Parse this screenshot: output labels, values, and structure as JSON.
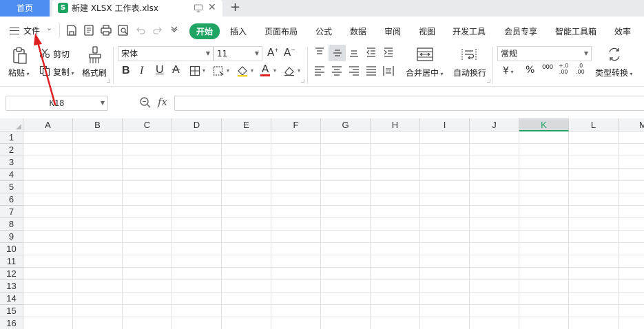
{
  "tabs": {
    "home_label": "首页",
    "doc_title": "新建 XLSX 工作表.xlsx",
    "doc_icon_letter": "S",
    "new_tab_symbol": "+"
  },
  "menu": {
    "file_label": "文件",
    "tabs": [
      "开始",
      "插入",
      "页面布局",
      "公式",
      "数据",
      "审阅",
      "视图",
      "开发工具",
      "会员专享",
      "智能工具箱",
      "效率"
    ],
    "active_tab": "开始"
  },
  "ribbon": {
    "paste": "粘贴",
    "cut": "剪切",
    "copy": "复制",
    "format_painter": "格式刷",
    "font_name": "宋体",
    "font_size": "11",
    "merge_center": "合并居中",
    "wrap_text": "自动换行",
    "number_format": "常规",
    "currency_symbol": "¥",
    "percent_symbol": "%",
    "thousands_symbol": "000",
    "type_convert": "类型转换"
  },
  "formula_bar": {
    "name_box": "K18",
    "fx_label": "fx",
    "formula_value": ""
  },
  "sheet": {
    "columns": [
      "A",
      "B",
      "C",
      "D",
      "E",
      "F",
      "G",
      "H",
      "I",
      "J",
      "K",
      "L",
      "M"
    ],
    "selected_column": "K",
    "rows": [
      "1",
      "2",
      "3",
      "4",
      "5",
      "6",
      "7",
      "8",
      "9",
      "10",
      "11",
      "12",
      "13",
      "14",
      "15",
      "16"
    ]
  },
  "colors": {
    "accent_green": "#1fa463",
    "home_tab_blue": "#4d8ef0",
    "annotation_red": "#e02020"
  }
}
